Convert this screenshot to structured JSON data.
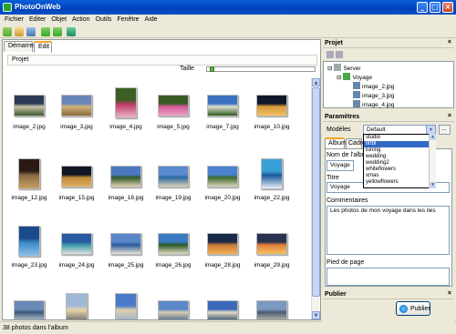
{
  "window": {
    "title": "PhotoOnWeb"
  },
  "menu": [
    "Fichier",
    "Editer",
    "Objet",
    "Action",
    "Outils",
    "Fenêtre",
    "Aide"
  ],
  "toolbar_icons": [
    "new-icon",
    "open-icon",
    "save-icon",
    "add-photos-icon",
    "remove-icon",
    "refresh-icon"
  ],
  "tabs": [
    {
      "label": "Démarrer",
      "active": false
    },
    {
      "label": "Edit",
      "active": true
    }
  ],
  "project_bar": {
    "label": "Projet"
  },
  "size": {
    "label": "Taille",
    "value": 0.03
  },
  "photos": [
    {
      "file": "image_2.jpg",
      "palette": [
        "#2c3a55",
        "#c9c0a8",
        "#3a5a2a"
      ]
    },
    {
      "file": "image_3.jpg",
      "palette": [
        "#6a86b8",
        "#d2b27a",
        "#8a6a3a"
      ]
    },
    {
      "file": "image_4.jpg",
      "palette": [
        "#3b5f24",
        "#c23a6a",
        "#e7b4c8"
      ]
    },
    {
      "file": "image_5.jpg",
      "palette": [
        "#3a5a25",
        "#d85a9a",
        "#e9a4c4"
      ]
    },
    {
      "file": "image_7.jpg",
      "palette": [
        "#3a72c0",
        "#e2e0d4",
        "#2f5d22"
      ]
    },
    {
      "file": "image_10.jpg",
      "palette": [
        "#10182a",
        "#d79a3a",
        "#f0c060"
      ]
    },
    {
      "file": "image_12.jpg",
      "palette": [
        "#2a1a12",
        "#8a6a44",
        "#c9a062"
      ]
    },
    {
      "file": "image_15.jpg",
      "palette": [
        "#101624",
        "#c08a3a",
        "#e0b060"
      ]
    },
    {
      "file": "image_18.jpg",
      "palette": [
        "#4a78c0",
        "#2f5a2a",
        "#e0d2b0"
      ]
    },
    {
      "file": "image_19.jpg",
      "palette": [
        "#5a8ad0",
        "#2a6aa0",
        "#d8d0b8"
      ]
    },
    {
      "file": "image_20.jpg",
      "palette": [
        "#4a82d0",
        "#3a6a30",
        "#dcd4b8"
      ]
    },
    {
      "file": "image_22.jpg",
      "palette": [
        "#3aa0d8",
        "#1a5a9a",
        "#e8f0f8"
      ]
    },
    {
      "file": "image_23.jpg",
      "palette": [
        "#1a4a8a",
        "#3a8ac8",
        "#8ac0e8"
      ]
    },
    {
      "file": "image_24.jpg",
      "palette": [
        "#2a5aa0",
        "#3a9aa8",
        "#e0e0e0"
      ]
    },
    {
      "file": "image_25.jpg",
      "palette": [
        "#5a86c8",
        "#2a5a9a",
        "#e8e4d8"
      ]
    },
    {
      "file": "image_26.jpg",
      "palette": [
        "#3a7ac0",
        "#2a5a2a",
        "#e0d8c0"
      ]
    },
    {
      "file": "image_28.jpg",
      "palette": [
        "#1a2a4a",
        "#c87a3a",
        "#f0b050"
      ]
    },
    {
      "file": "image_29.jpg",
      "palette": [
        "#2a3250",
        "#e0803a",
        "#f4c060"
      ]
    },
    {
      "file": "",
      "palette": [
        "#6a8ab8",
        "#3a5a7a",
        "#c0c8d0"
      ]
    },
    {
      "file": "",
      "palette": [
        "#a0b8d8",
        "#e8d8a8",
        "#5a5a6a"
      ]
    },
    {
      "file": "",
      "palette": [
        "#4a7ac8",
        "#e0d0b0",
        "#8aaad0"
      ]
    },
    {
      "file": "",
      "palette": [
        "#5a88c8",
        "#d8ccb0",
        "#4a6a8a"
      ]
    },
    {
      "file": "",
      "palette": [
        "#3a6ab8",
        "#e4dcc8",
        "#2a4a6a"
      ]
    },
    {
      "file": "",
      "palette": [
        "#7a98c0",
        "#4a5a70",
        "#c8c0b0"
      ]
    }
  ],
  "status": {
    "text": "38 photos dans l'album"
  },
  "project_panel": {
    "title": "Projet",
    "tree": [
      {
        "label": "Server",
        "level": 0,
        "icon": "server-icon"
      },
      {
        "label": "Voyage",
        "level": 1,
        "icon": "album-icon"
      },
      {
        "label": "image_2.jpg",
        "level": 2,
        "icon": "image-icon"
      },
      {
        "label": "image_3.jpg",
        "level": 2,
        "icon": "image-icon"
      },
      {
        "label": "image_4.jpg",
        "level": 2,
        "icon": "image-icon"
      }
    ]
  },
  "params_panel": {
    "title": "Paramètres",
    "models_label": "Modèles",
    "models_value": "Default",
    "models_more": "...",
    "subtabs": [
      "Album",
      "Cadre"
    ],
    "album_name_label": "Nom de l'album",
    "album_name_value": "Voyage",
    "title_label": "Titre",
    "title_value": "Voyage",
    "comments_label": "Commentaires",
    "comments_value": "Les photos de mon voyage dans les iles",
    "footer_label": "Pied de page",
    "footer_value": "",
    "dropdown_options": [
      "studio",
      "tlrtbl",
      "tuning",
      "wedding",
      "wedding2",
      "whiteflowers",
      "xmas",
      "yellowflowers"
    ],
    "dropdown_selected": 1
  },
  "publish_panel": {
    "title": "Publier",
    "button": "Publier"
  }
}
